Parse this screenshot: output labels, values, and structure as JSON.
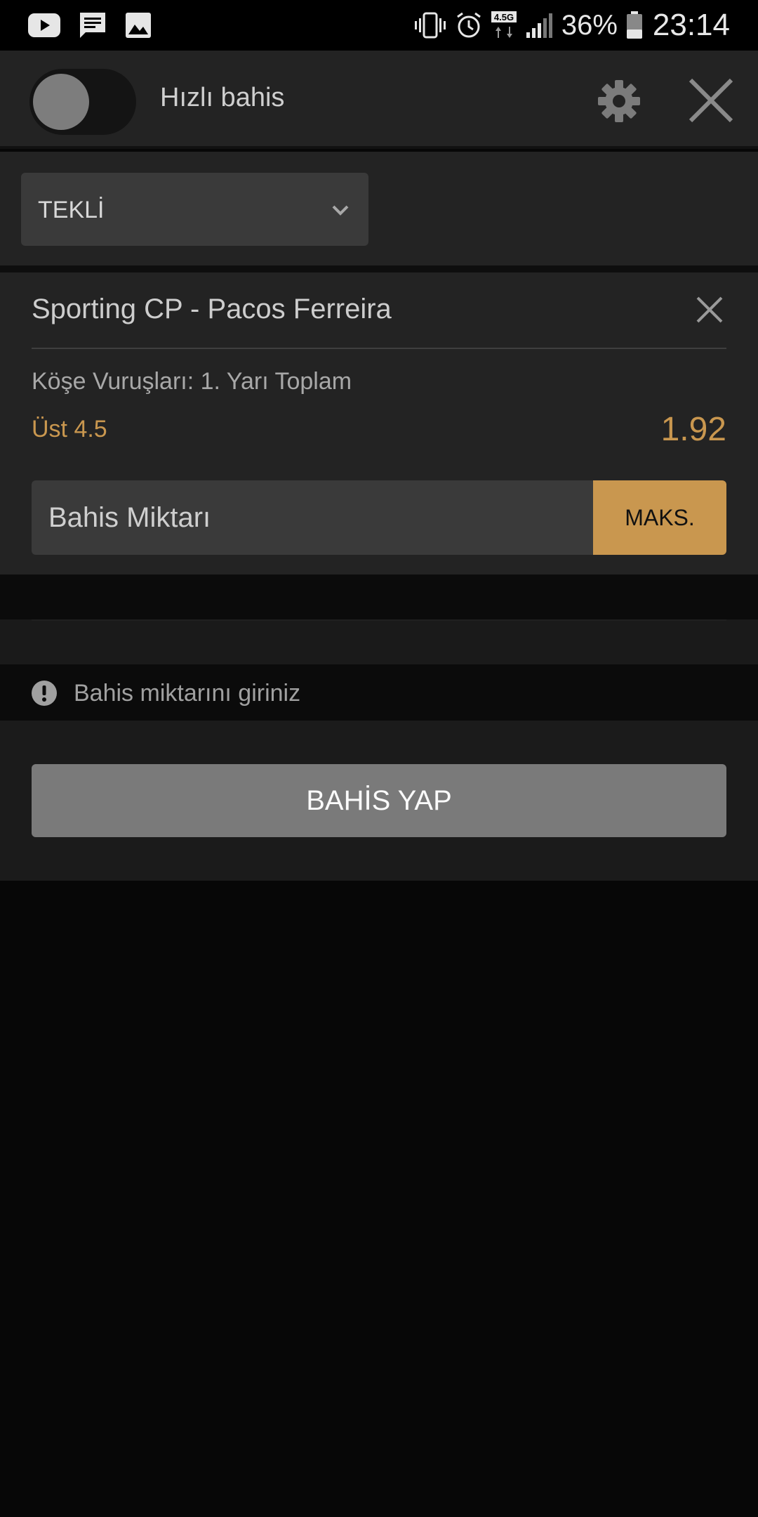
{
  "status_bar": {
    "battery_percent": "36%",
    "network": "4.5G",
    "time": "23:14",
    "icons": [
      "youtube-icon",
      "message-icon",
      "gallery-icon",
      "vibrate-icon",
      "alarm-icon",
      "network-icon",
      "signal-icon",
      "battery-icon"
    ]
  },
  "header": {
    "quick_bet_label": "Hızlı bahis",
    "quick_bet_enabled": false
  },
  "bet_type": {
    "selected": "TEKLİ"
  },
  "bet": {
    "match": "Sporting CP - Pacos Ferreira",
    "market": "Köşe Vuruşları: 1. Yarı Toplam",
    "selection": "Üst 4.5",
    "odds": "1.92",
    "stake_placeholder": "Bahis Miktarı",
    "max_label": "MAKS."
  },
  "warning": {
    "text": "Bahis miktarını giriniz"
  },
  "place_bet": {
    "label": "BAHİS YAP"
  },
  "colors": {
    "accent": "#c9974f",
    "panel": "#232323",
    "background": "#070707",
    "button_disabled": "#7a7a7a"
  }
}
